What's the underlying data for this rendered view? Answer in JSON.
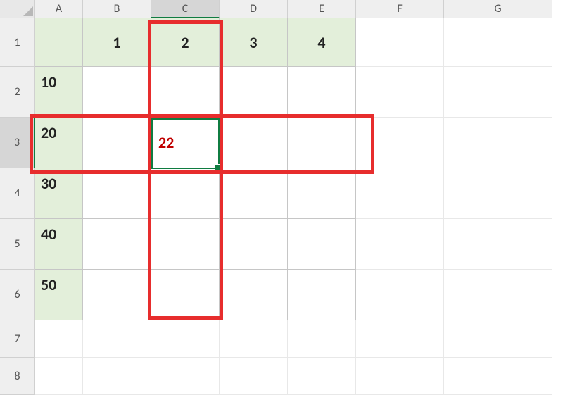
{
  "columns": [
    "A",
    "B",
    "C",
    "D",
    "E",
    "F",
    "G"
  ],
  "rows": [
    "1",
    "2",
    "3",
    "4",
    "5",
    "6",
    "7",
    "8"
  ],
  "selected_col": "C",
  "selected_row": "3",
  "top_headers": {
    "B1": "1",
    "C1": "2",
    "D1": "3",
    "E1": "4"
  },
  "left_headers": {
    "A2": "10",
    "A3": "20",
    "A4": "30",
    "A5": "40",
    "A6": "50"
  },
  "active_cell": {
    "ref": "C3",
    "value": "22"
  },
  "chart_data": {
    "type": "table",
    "top": [
      "1",
      "2",
      "3",
      "4"
    ],
    "left": [
      "10",
      "20",
      "30",
      "40",
      "50"
    ],
    "populated": {
      "row_label": "20",
      "col_label": "2",
      "value": "22"
    }
  }
}
